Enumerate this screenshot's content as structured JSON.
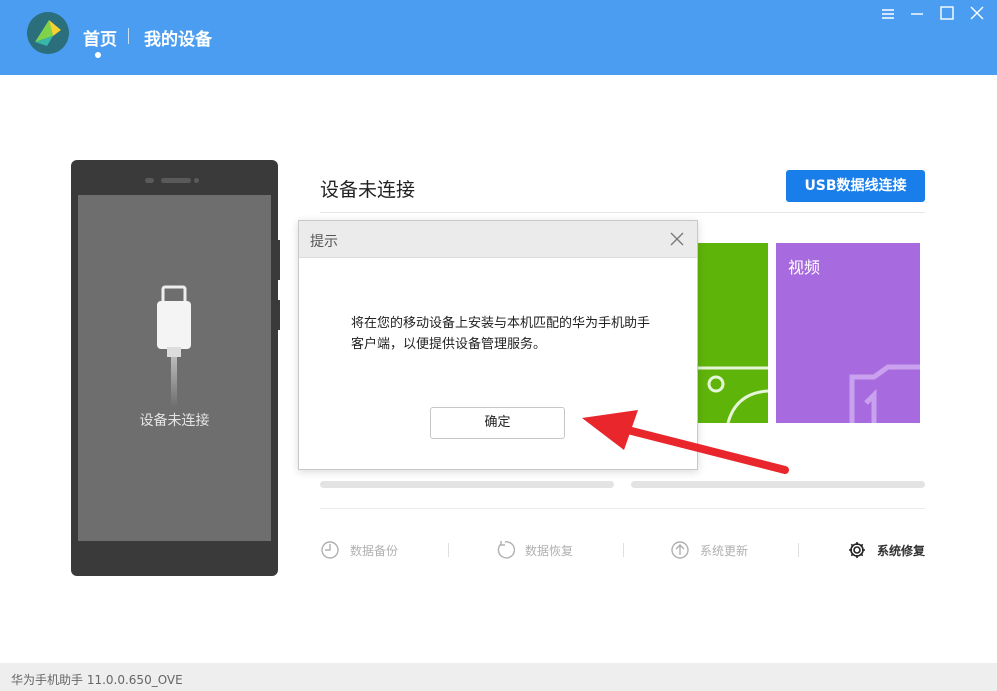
{
  "header": {
    "nav_home": "首页",
    "nav_devices": "我的设备",
    "accent_color": "#4a9df0",
    "window_controls": [
      "menu-icon",
      "minimize-icon",
      "maximize-icon",
      "close-icon"
    ]
  },
  "phone": {
    "status_text": "设备未连接"
  },
  "main": {
    "title": "设备未连接",
    "usb_button": "USB数据线连接",
    "tiles": [
      {
        "label": "",
        "color": "#5fb40a"
      },
      {
        "label": "视频",
        "color": "#a86bdf"
      }
    ],
    "tools": [
      {
        "label": "数据备份",
        "icon": "backup-clock-icon",
        "active": false
      },
      {
        "label": "数据恢复",
        "icon": "restore-icon",
        "active": false
      },
      {
        "label": "系统更新",
        "icon": "update-arrow-icon",
        "active": false
      },
      {
        "label": "系统修复",
        "icon": "gear-icon",
        "active": true
      }
    ]
  },
  "dialog": {
    "title": "提示",
    "message": "将在您的移动设备上安装与本机匹配的华为手机助手客户端，以便提供设备管理服务。",
    "ok_label": "确定"
  },
  "footer": {
    "version_text": "华为手机助手 11.0.0.650_OVE"
  },
  "annotation": {
    "arrow_color": "#e8262b"
  }
}
